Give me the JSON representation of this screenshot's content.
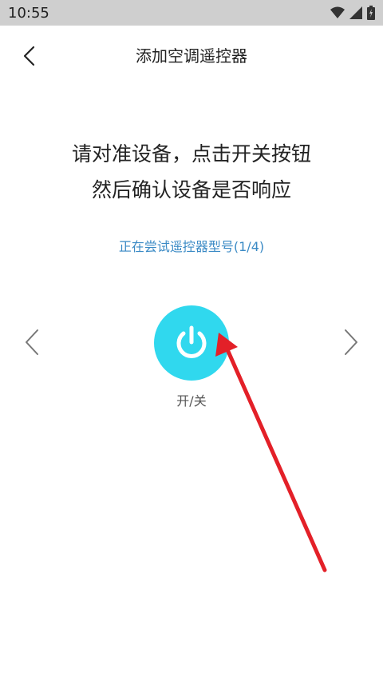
{
  "status_bar": {
    "time": "10:55",
    "icons": [
      "wifi-icon",
      "signal-icon",
      "battery-icon"
    ]
  },
  "header": {
    "title": "添加空调遥控器"
  },
  "main": {
    "instruction_line1": "请对准设备，点击开关按钮",
    "instruction_line2": "然后确认设备是否响应",
    "trying_status": "正在尝试遥控器型号(1/4)",
    "power_label": "开/关"
  },
  "colors": {
    "accent": "#30d8ee",
    "status_text": "#3a8ac5",
    "annotation_arrow": "#e32028"
  }
}
